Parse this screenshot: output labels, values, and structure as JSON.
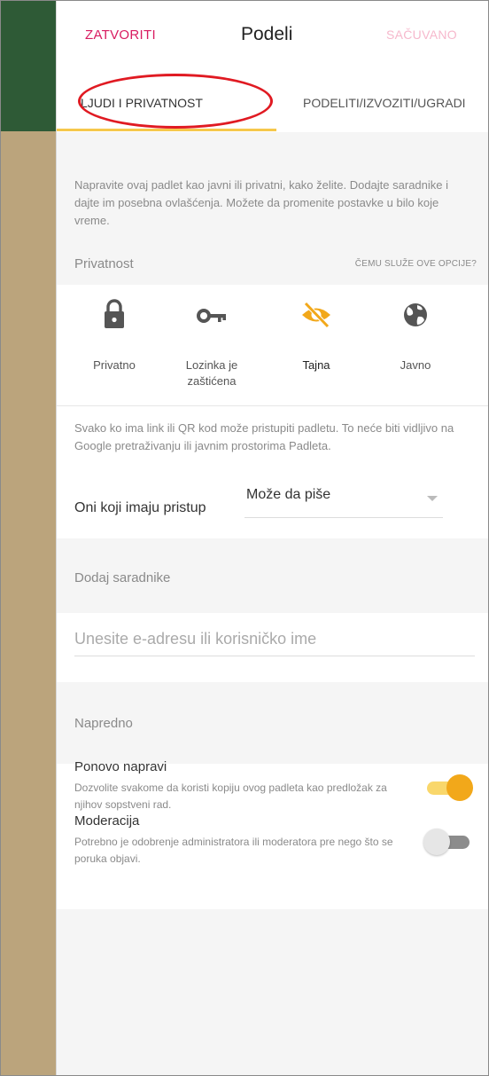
{
  "header": {
    "close_label": "ZATVORITI",
    "title": "Podeli",
    "saved_label": "SAČUVANO"
  },
  "tabs": [
    {
      "label": "LJUDI I PRIVATNOST",
      "selected": true
    },
    {
      "label": "PODELITI/IZVOZITI/UGRADI",
      "selected": false
    }
  ],
  "intro_text": "Napravite ovaj padlet kao javni ili privatni, kako želite. Dodajte saradnike i dajte im posebna ovlašćenja. Možete da promenite postavke u bilo koje vreme.",
  "privacy": {
    "title": "Privatnost",
    "help_link": "ČEMU SLUŽE OVE OPCIJE?",
    "options": [
      {
        "label": "Privatno",
        "icon": "lock-icon",
        "selected": false
      },
      {
        "label": "Lozinka je zaštićena",
        "icon": "key-icon",
        "selected": false
      },
      {
        "label": "Tajna",
        "icon": "eye-off-icon",
        "selected": true
      },
      {
        "label": "Javno",
        "icon": "globe-icon",
        "selected": false
      }
    ],
    "description": "Svako ko ima link ili QR kod može pristupiti padletu. To neće biti vidljivo na Google pretraživanju ili javnim prostorima Padleta.",
    "access_label": "Oni koji imaju pristup",
    "access_value": "Može da piše"
  },
  "collaborators": {
    "title": "Dodaj saradnike",
    "input_placeholder": "Unesite e-adresu ili korisničko ime"
  },
  "advanced": {
    "title": "Napredno",
    "settings": [
      {
        "title": "Ponovo napravi",
        "description": "Dozvolite svakome da koristi kopiju ovog padleta kao predložak za njihov sopstveni rad.",
        "enabled": true
      },
      {
        "title": "Moderacija",
        "description": "Potrebno je odobrenje administratora ili moderatora pre nego što se poruka objavi.",
        "enabled": false
      }
    ]
  },
  "colors": {
    "accent_pink": "#d81b60",
    "selected_yellow": "#f2a81a",
    "tab_indicator": "#f6c84c",
    "annotation_red": "#e01a22",
    "sidebar_green": "#2e5a36",
    "sidebar_tan": "#bba47c"
  }
}
